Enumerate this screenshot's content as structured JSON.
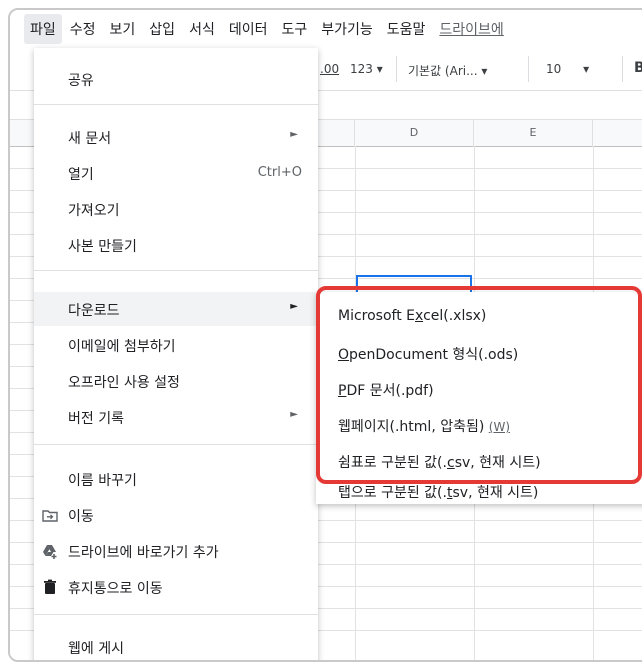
{
  "menubar": {
    "items": [
      "파일",
      "수정",
      "보기",
      "삽입",
      "서식",
      "데이터",
      "도구",
      "부가기능",
      "도움말"
    ],
    "link": "드라이브에"
  },
  "toolbar": {
    "decimal": ".00",
    "format": "123",
    "font": "기본값 (Ari...",
    "size": "10",
    "bold": "B"
  },
  "columns": [
    "D",
    "E"
  ],
  "file_menu": {
    "share": "공유",
    "new": "새 문서",
    "open": "열기",
    "open_shortcut": "Ctrl+O",
    "import": "가져오기",
    "make_copy": "사본 만들기",
    "download": "다운로드",
    "email": "이메일에 첨부하기",
    "offline": "오프라인 사용 설정",
    "version": "버전 기록",
    "rename": "이름 바꾸기",
    "move": "이동",
    "add_shortcut": "드라이브에 바로가기 추가",
    "trash": "휴지통으로 이동",
    "publish": "웹에 게시",
    "arrow": "►"
  },
  "download_submenu": {
    "xlsx_pre": "Microsoft E",
    "xlsx_u": "x",
    "xlsx_post": "cel(.xlsx)",
    "ods_u": "O",
    "ods_post": "penDocument 형식(.ods)",
    "pdf_u": "P",
    "pdf_post": "DF 문서(.pdf)",
    "html": "웹페이지(.html, 압축됨)",
    "html_key": "(W)",
    "csv_pre": "쉼표로 구분된 값(.",
    "csv_u": "c",
    "csv_post": "sv, 현재 시트)",
    "tsv_pre": "탭으로 구분된 값(.",
    "tsv_u": "t",
    "tsv_post": "sv, 현재 시트)"
  },
  "colors": {
    "highlight_box": "#e53935",
    "selection": "#1a73e8",
    "menu_hover": "#f1f3f4"
  }
}
